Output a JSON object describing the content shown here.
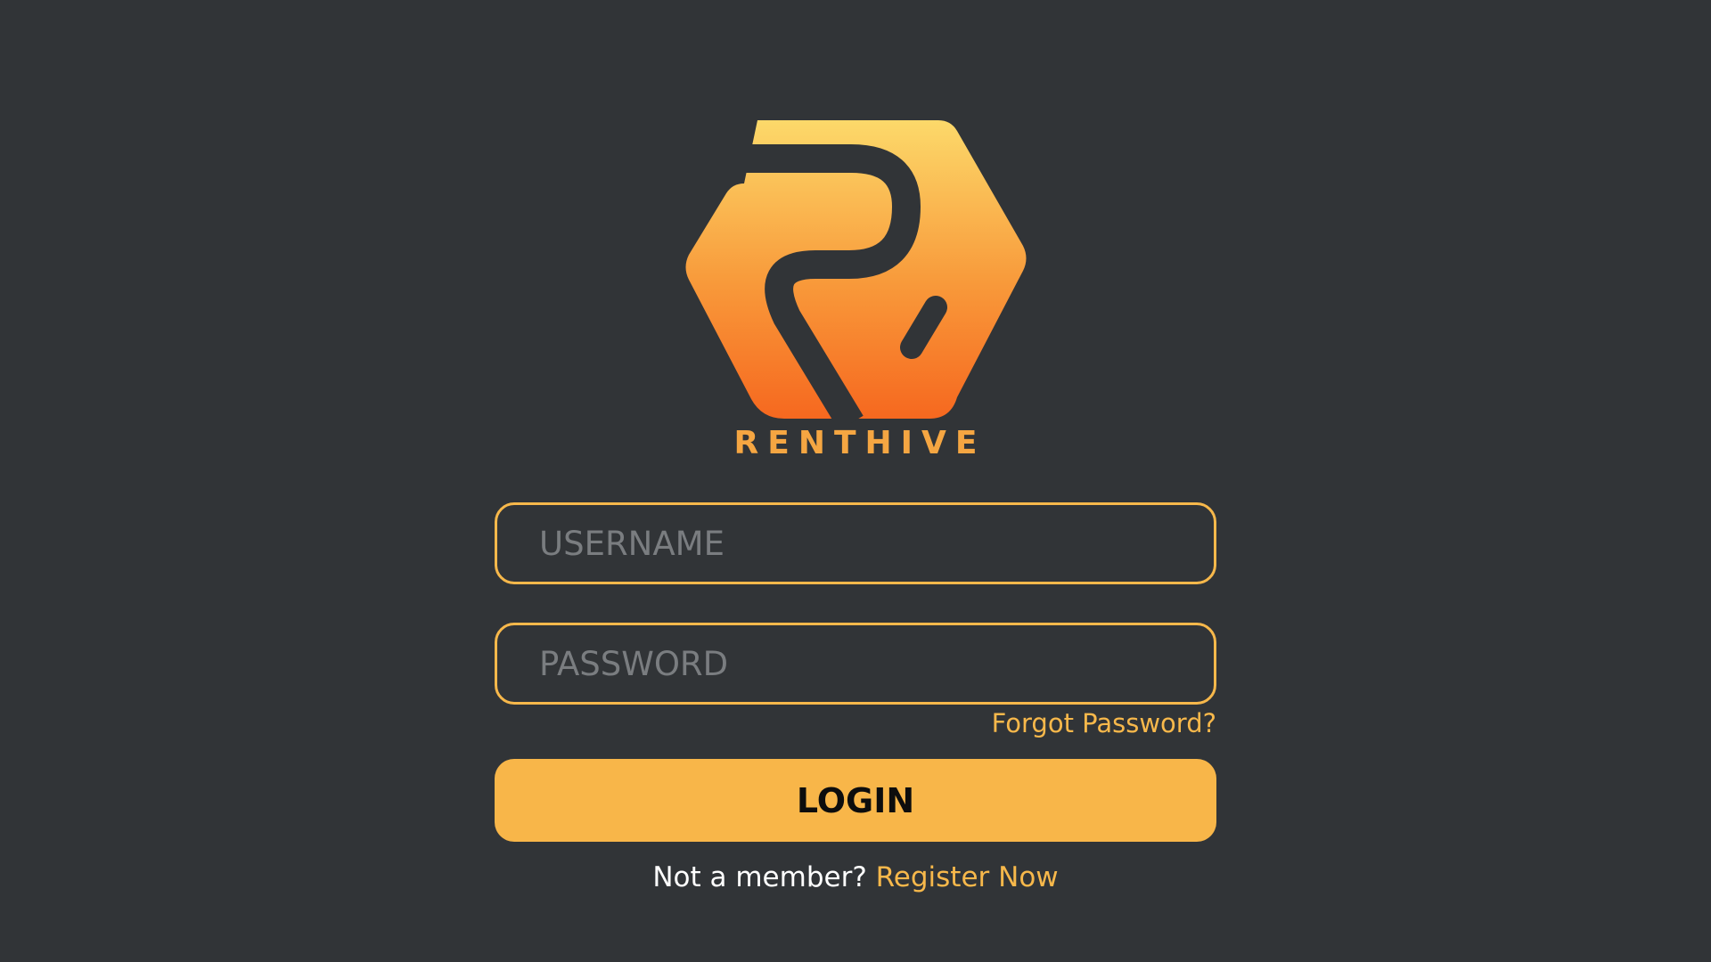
{
  "brand": {
    "name": "RENTHIVE",
    "logo_icon": "renthive-hexagon-logo"
  },
  "form": {
    "username_placeholder": "USERNAME",
    "password_placeholder": "PASSWORD",
    "forgot_password": "Forgot Password?",
    "login_label": "LOGIN"
  },
  "register": {
    "prompt": "Not a member?",
    "link": "Register Now"
  },
  "colors": {
    "background": "#313437",
    "accent": "#f8b649",
    "logo_gradient_top": "#fcd96a",
    "logo_gradient_bottom": "#f6681f"
  }
}
